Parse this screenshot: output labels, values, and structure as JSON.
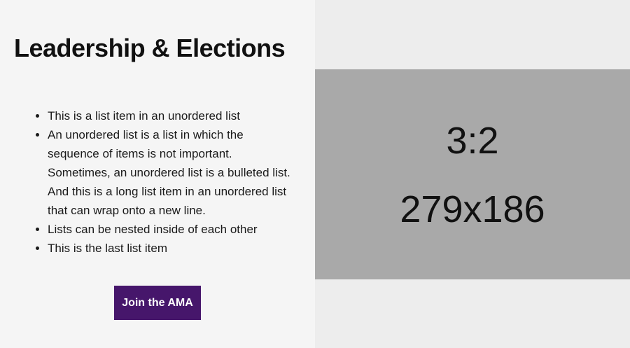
{
  "content": {
    "title": "Leadership & Elections",
    "list_items": [
      "This is a list item in an unordered list",
      "An unordered list is a list in which the sequence of items is not important. Sometimes, an unordered list is a bulleted list. And this is a long list item in an unordered list that can wrap onto a new line.",
      "Lists can be nested inside of each other",
      "This is the last list item"
    ],
    "button_label": "Join the AMA"
  },
  "image_placeholder": {
    "ratio_text": "3:2",
    "size_text": "279x186"
  },
  "colors": {
    "button_bg": "#46166b",
    "left_bg": "#f5f5f5",
    "right_bg": "#ededed",
    "placeholder_bg": "#a9a9a9"
  }
}
